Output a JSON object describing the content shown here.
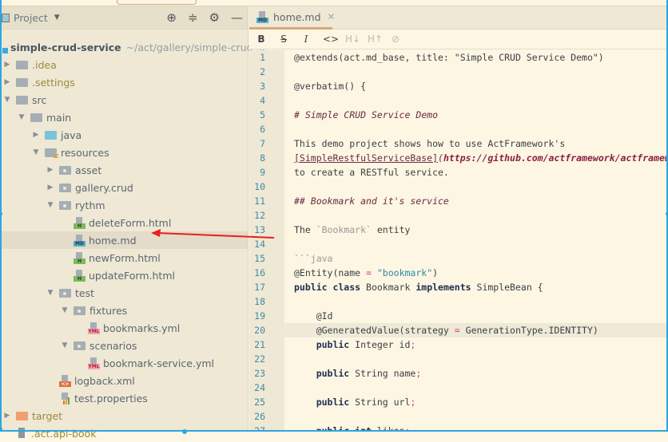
{
  "sidebar": {
    "title": "Project",
    "tree": [
      {
        "label": "simple-crud-service",
        "path": "~/act/gallery/simple-crud-se",
        "level": 0,
        "kind": "module",
        "root": true
      },
      {
        "label": ".idea",
        "level": 1,
        "kind": "folder",
        "arrow": "closed",
        "olive": true
      },
      {
        "label": ".settings",
        "level": 1,
        "kind": "folder",
        "arrow": "closed",
        "olive": true
      },
      {
        "label": "src",
        "level": 1,
        "kind": "folder",
        "arrow": "open"
      },
      {
        "label": "main",
        "level": 2,
        "kind": "folder",
        "arrow": "open"
      },
      {
        "label": "java",
        "level": 3,
        "kind": "blue",
        "arrow": "closed"
      },
      {
        "label": "resources",
        "level": 3,
        "kind": "res",
        "arrow": "open"
      },
      {
        "label": "asset",
        "level": 4,
        "kind": "pkg",
        "arrow": "closed"
      },
      {
        "label": "gallery.crud",
        "level": 4,
        "kind": "pkg",
        "arrow": "closed"
      },
      {
        "label": "rythm",
        "level": 4,
        "kind": "pkg",
        "arrow": "open"
      },
      {
        "label": "deleteForm.html",
        "level": 5,
        "kind": "file",
        "tag": "H"
      },
      {
        "label": "home.md",
        "level": 5,
        "kind": "file",
        "tag": "MD",
        "selected": true
      },
      {
        "label": "newForm.html",
        "level": 5,
        "kind": "file",
        "tag": "H"
      },
      {
        "label": "updateForm.html",
        "level": 5,
        "kind": "file",
        "tag": "H"
      },
      {
        "label": "test",
        "level": 4,
        "kind": "pkg",
        "arrow": "open"
      },
      {
        "label": "fixtures",
        "level": 5,
        "kind": "pkg",
        "arrow": "open"
      },
      {
        "label": "bookmarks.yml",
        "level": 6,
        "kind": "file",
        "tag": "YML"
      },
      {
        "label": "scenarios",
        "level": 5,
        "kind": "pkg",
        "arrow": "open"
      },
      {
        "label": "bookmark-service.yml",
        "level": 6,
        "kind": "file",
        "tag": "YML"
      },
      {
        "label": "logback.xml",
        "level": 4,
        "kind": "file",
        "tag": "<>"
      },
      {
        "label": "test.properties",
        "level": 4,
        "kind": "file",
        "tag": "props"
      },
      {
        "label": "target",
        "level": 1,
        "kind": "orange",
        "arrow": "closed",
        "olive": true
      },
      {
        "label": ".act.api-book",
        "level": 1,
        "kind": "text",
        "olive": true
      }
    ]
  },
  "editor": {
    "tab": {
      "label": "home.md",
      "icon": "MD"
    },
    "toolbar": [
      "B",
      "S",
      "I",
      "<>",
      "H↓",
      "H↑",
      "link"
    ],
    "current_line": 20,
    "lines": [
      [
        [
          "",
          "@extends(act.md_base, title: \"Simple CRUD Service Demo\")"
        ]
      ],
      [],
      [
        [
          "",
          "@verbatim() {"
        ]
      ],
      [],
      [
        [
          "h",
          "# Simple CRUD Service Demo"
        ]
      ],
      [],
      [
        [
          "",
          "This demo project shows how to use ActFramework's"
        ]
      ],
      [
        [
          "u",
          "[SimpleRestfulServiceBase]"
        ],
        [
          "h",
          "("
        ],
        [
          "l",
          "https://github.com/actframework/actframework"
        ]
      ],
      [
        [
          "",
          "to create a RESTful service."
        ]
      ],
      [],
      [
        [
          "h",
          "## Bookmark and it's service"
        ]
      ],
      [],
      [
        [
          "",
          "The "
        ],
        [
          "c",
          "`Bookmark`"
        ],
        [
          "",
          " entity"
        ]
      ],
      [],
      [
        [
          "c",
          "```java"
        ]
      ],
      [
        [
          "",
          "@Entity(name "
        ],
        [
          "p",
          "="
        ],
        [
          "s",
          " \"bookmark\""
        ],
        [
          "",
          ")"
        ]
      ],
      [
        [
          "k",
          "public class"
        ],
        [
          "",
          " Bookmark "
        ],
        [
          "k",
          "implements"
        ],
        [
          "",
          " SimpleBean {"
        ]
      ],
      [],
      [
        [
          "",
          "    @Id"
        ]
      ],
      [
        [
          "",
          "    @GeneratedValue(strategy "
        ],
        [
          "p",
          "="
        ],
        [
          "",
          " GenerationType.IDENTITY)"
        ]
      ],
      [
        [
          "k",
          "    public"
        ],
        [
          "",
          " Integer id"
        ],
        [
          "p",
          ";"
        ]
      ],
      [],
      [
        [
          "k",
          "    public"
        ],
        [
          "",
          " String name"
        ],
        [
          "p",
          ";"
        ]
      ],
      [],
      [
        [
          "k",
          "    public"
        ],
        [
          "",
          " String url"
        ],
        [
          "p",
          ";"
        ]
      ],
      [],
      [
        [
          "k",
          "    public int"
        ],
        [
          "",
          " likes"
        ],
        [
          "p",
          ";"
        ]
      ]
    ]
  },
  "colors": {
    "accent": "#2ea6e0",
    "annotation_arrow": "#e82020"
  }
}
